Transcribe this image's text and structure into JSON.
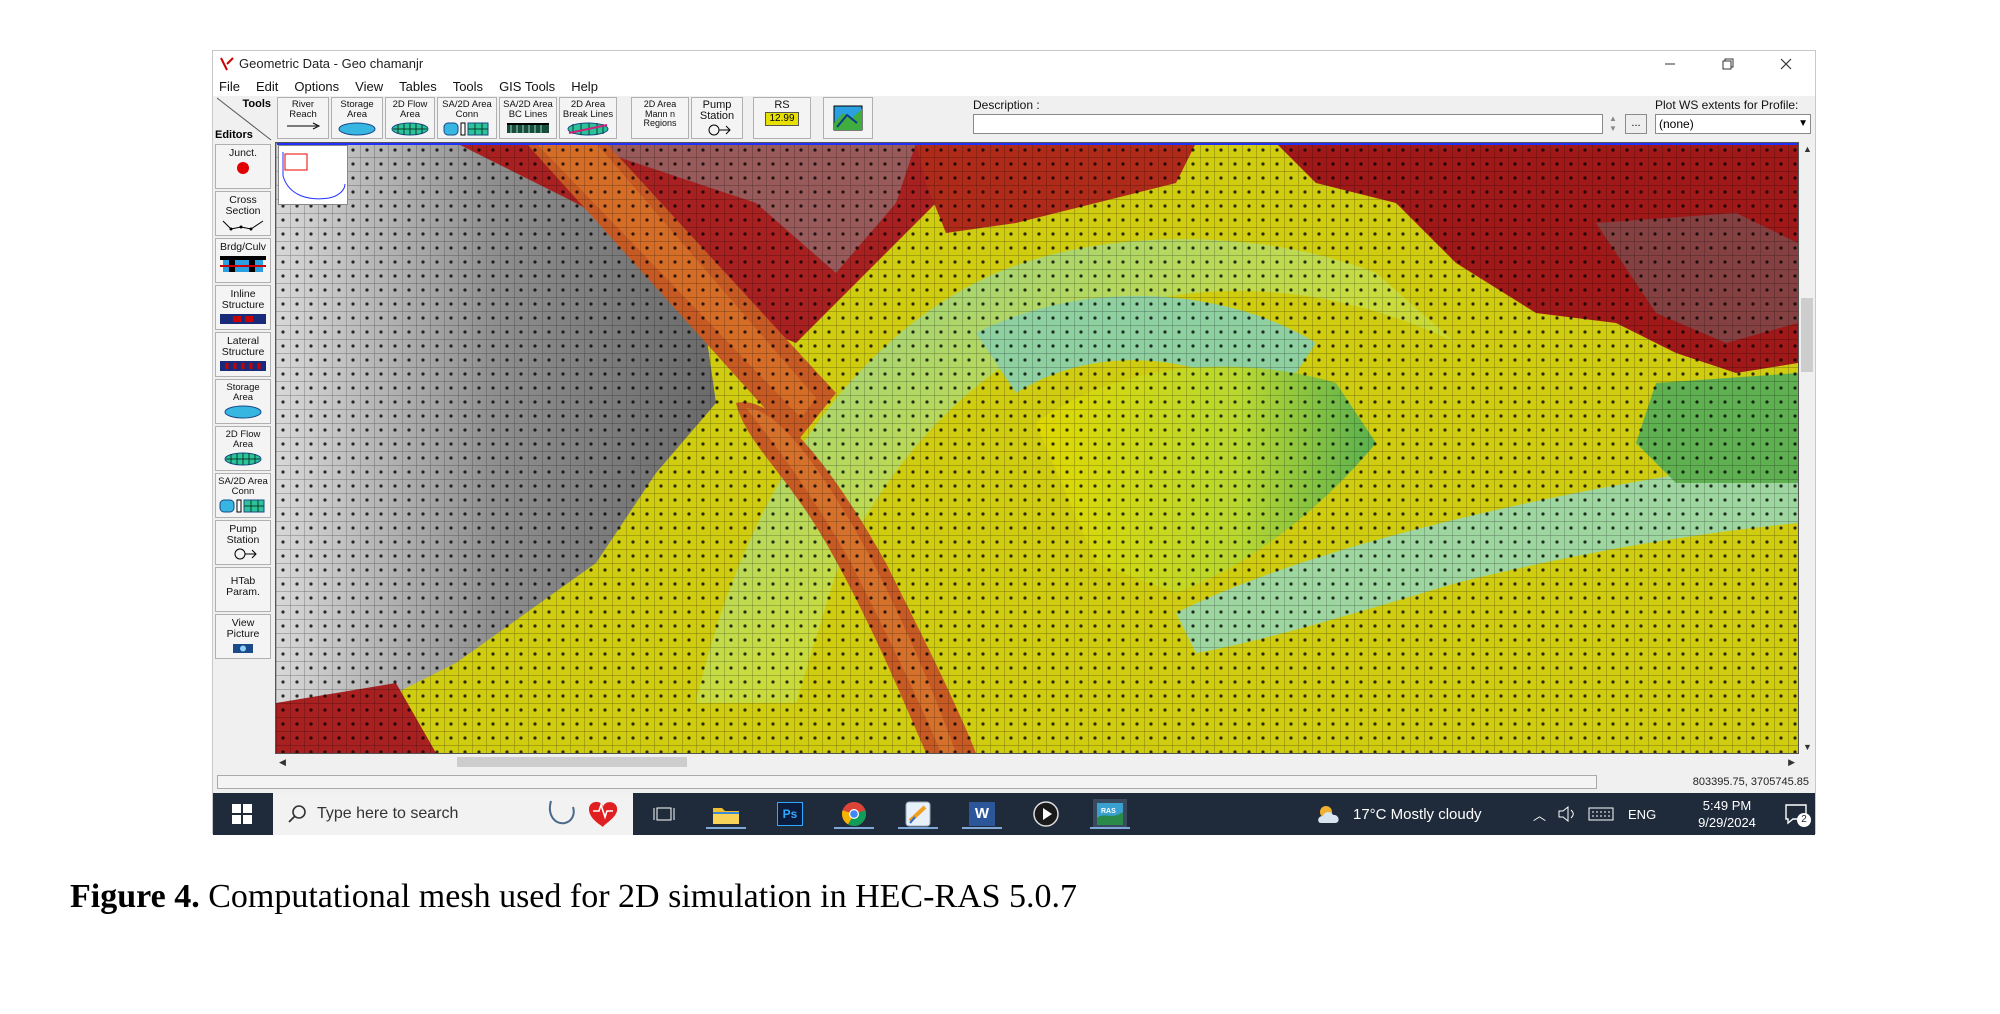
{
  "window": {
    "title": "Geometric Data - Geo chamanjr",
    "min_icon": "minimize-icon",
    "max_icon": "restore-icon",
    "close_icon": "close-icon"
  },
  "menu": [
    "File",
    "Edit",
    "Options",
    "View",
    "Tables",
    "Tools",
    "GIS Tools",
    "Help"
  ],
  "toolbar": {
    "tools_label": "Tools",
    "editors_label": "Editors",
    "buttons": [
      {
        "label": "River\nReach"
      },
      {
        "label": "Storage\nArea"
      },
      {
        "label": "2D Flow\nArea"
      },
      {
        "label": "SA/2D Area\nConn"
      },
      {
        "label": "SA/2D Area\nBC Lines"
      },
      {
        "label": "2D Area\nBreak Lines"
      },
      {
        "label": "2D Area\nMann n\nRegions"
      },
      {
        "label": "Pump\nStation"
      },
      {
        "label": "RS",
        "value": "12.99"
      }
    ],
    "description_label": "Description :",
    "description_value": "",
    "ellipsis": "...",
    "plot_label": "Plot WS extents for Profile:",
    "plot_value": "(none)"
  },
  "editors": [
    {
      "label": "Junct."
    },
    {
      "label": "Cross\nSection"
    },
    {
      "label": "Brdg/Culv"
    },
    {
      "label": "Inline\nStructure"
    },
    {
      "label": "Lateral\nStructure"
    },
    {
      "label": "Storage\nArea"
    },
    {
      "label": "2D Flow\nArea"
    },
    {
      "label": "SA/2D Area\nConn"
    },
    {
      "label": "Pump\nStation"
    },
    {
      "label": "HTab\nParam."
    },
    {
      "label": "View\nPicture"
    }
  ],
  "status": {
    "coordinates": "803395.75, 3705745.85"
  },
  "taskbar": {
    "search_placeholder": "Type here to search",
    "weather": "17°C  Mostly cloudy",
    "language": "ENG",
    "time": "5:49 PM",
    "date": "9/29/2024",
    "notification_count": "2",
    "apps": [
      "task-view-icon",
      "file-explorer-icon",
      "photoshop-icon",
      "chrome-icon",
      "paint-icon",
      "word-icon",
      "media-player-icon",
      "hec-ras-icon"
    ]
  },
  "caption": {
    "label": "Figure 4.",
    "text": " Computational mesh used for 2D simulation in HEC-RAS 5.0.7"
  },
  "colors": {
    "taskbar": "#1f2b3b",
    "terrain_high": "#a31a1a",
    "terrain_mid": "#d9d400",
    "terrain_low": "#6fbf70",
    "channel": "#c75a23"
  }
}
